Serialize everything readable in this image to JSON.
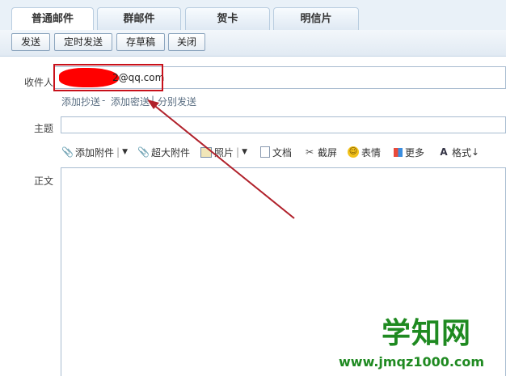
{
  "tabs": [
    "普通邮件",
    "群邮件",
    "贺卡",
    "明信片"
  ],
  "toolbar": {
    "send": "发送",
    "scheduled_send": "定时发送",
    "save_draft": "存草稿",
    "close": "关闭"
  },
  "compose": {
    "to_label": "收件人",
    "to_value": "2@qq.com",
    "add_cc": "添加抄送",
    "dash": "-",
    "add_bcc": "添加密送",
    "pipe": "|",
    "separate_send": "分别发送",
    "subject_label": "主题",
    "body_label": "正文"
  },
  "editor_tools": {
    "attach": "添加附件",
    "large_attach": "超大附件",
    "photo": "照片",
    "doc": "文档",
    "screenshot": "截屏",
    "emoji": "表情",
    "more": "更多",
    "format": "格式"
  },
  "watermark": {
    "main": "学知网",
    "sub": "www.jmqz1000.com"
  },
  "colors": {
    "tab_bar": "#e9f1f8",
    "highlight_box": "#c8101a",
    "arrow": "#b0202a",
    "watermark": "#1f8a21"
  }
}
